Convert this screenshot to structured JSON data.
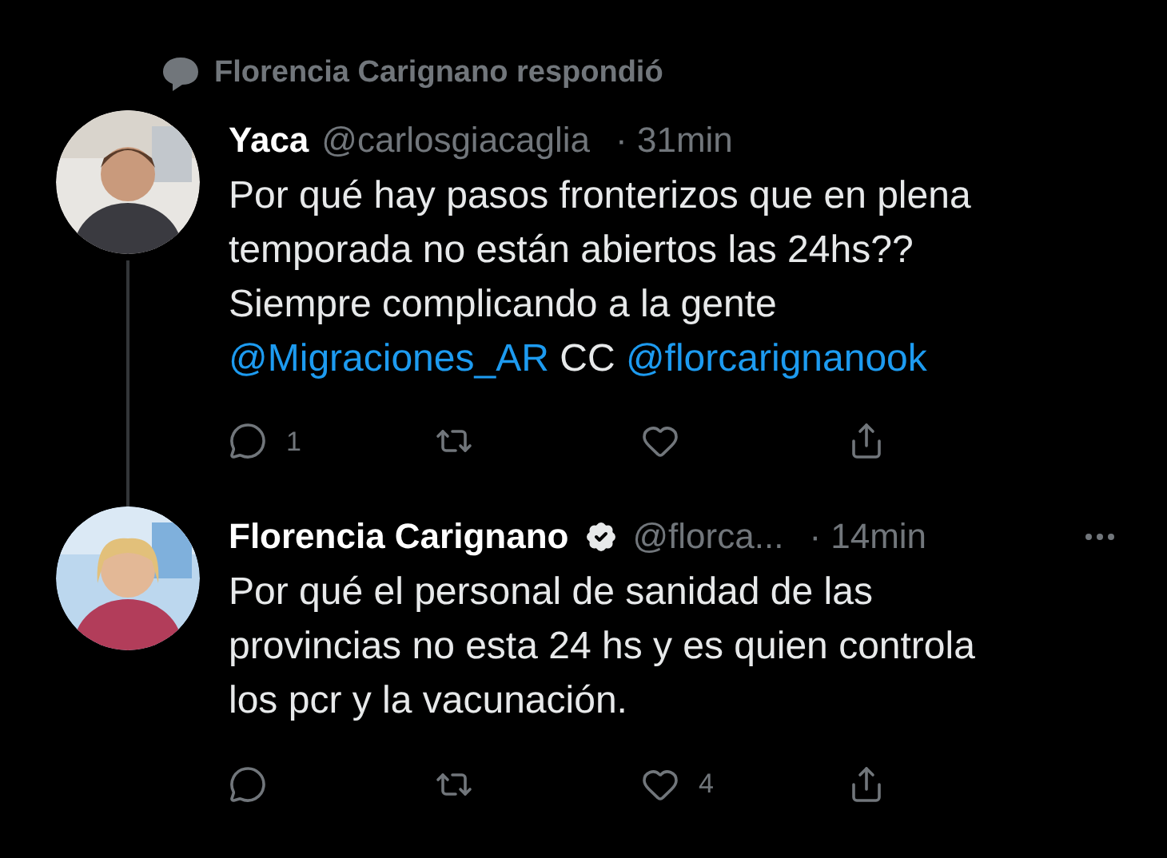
{
  "context": {
    "text": "Florencia Carignano respondió"
  },
  "tweets": [
    {
      "author": "Yaca",
      "verified": false,
      "handle": "@carlosgiacaglia",
      "time": "· 31min",
      "more": false,
      "body": [
        [
          {
            "kind": "text",
            "text": "Por qué hay pasos fronterizos que en plena"
          }
        ],
        [
          {
            "kind": "text",
            "text": "temporada no están abiertos las 24hs??"
          }
        ],
        [
          {
            "kind": "text",
            "text": "Siempre complicando a la gente"
          }
        ],
        [
          {
            "kind": "mention",
            "text": "@Migraciones_AR"
          },
          {
            "kind": "text",
            "text": " CC "
          },
          {
            "kind": "mention",
            "text": "@florcarignanook"
          }
        ]
      ],
      "actions": [
        {
          "kind": "reply",
          "count": "1"
        },
        {
          "kind": "retweet"
        },
        {
          "kind": "like"
        },
        {
          "kind": "share"
        }
      ]
    },
    {
      "author": "Florencia Carignano",
      "verified": true,
      "handle": "@florca...",
      "time": "· 14min",
      "more": true,
      "body": [
        [
          {
            "kind": "text",
            "text": "Por qué el personal de sanidad de las"
          }
        ],
        [
          {
            "kind": "text",
            "text": "provincias no esta 24 hs y es quien controla"
          }
        ],
        [
          {
            "kind": "text",
            "text": "los pcr y la vacunación."
          }
        ]
      ],
      "actions": [
        {
          "kind": "reply"
        },
        {
          "kind": "retweet"
        },
        {
          "kind": "like",
          "count": "4"
        },
        {
          "kind": "share"
        }
      ]
    }
  ]
}
